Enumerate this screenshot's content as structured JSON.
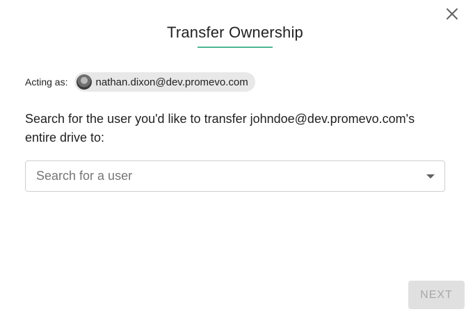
{
  "dialog": {
    "title": "Transfer Ownership",
    "accent_color": "#4db891",
    "close_icon": "close-icon"
  },
  "acting_as": {
    "label": "Acting as:",
    "email": "nathan.dixon@dev.promevo.com",
    "avatar_icon": "avatar"
  },
  "prompt": {
    "text": "Search for the user you'd like to transfer johndoe@dev.promevo.com's entire drive to:"
  },
  "search": {
    "placeholder": "Search for a user",
    "value": "",
    "dropdown_icon": "caret-down-icon"
  },
  "footer": {
    "next_label": "NEXT",
    "next_disabled": true
  }
}
